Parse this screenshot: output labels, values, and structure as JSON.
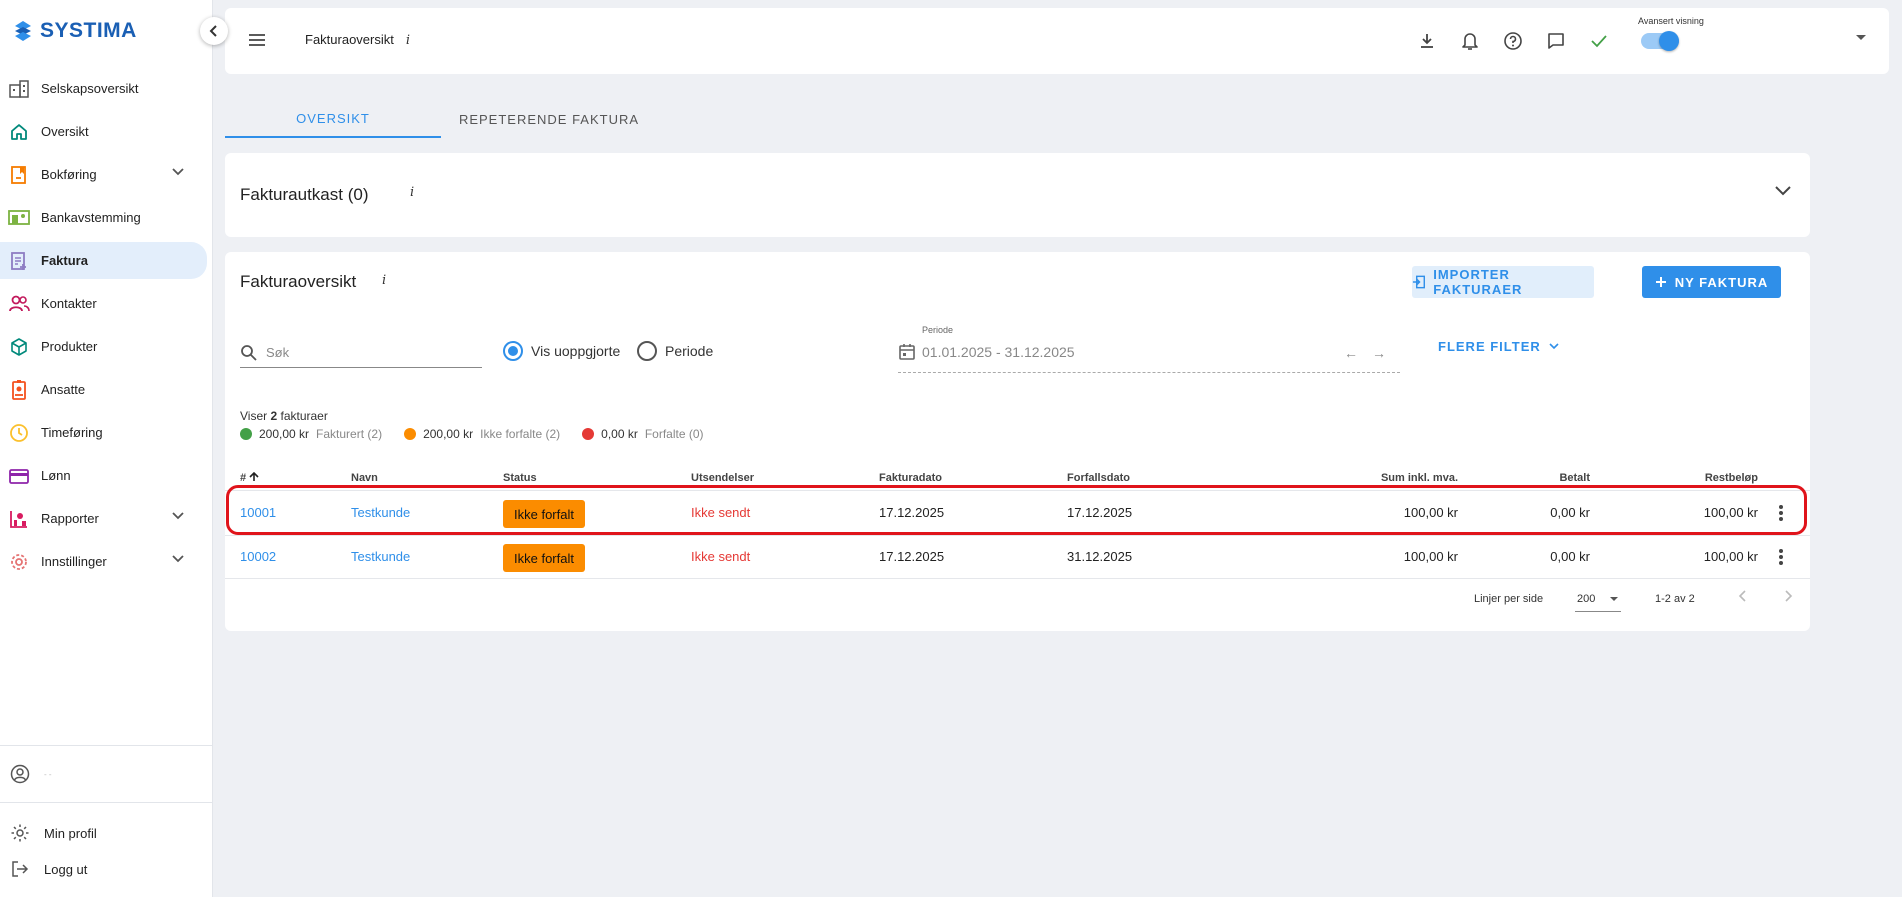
{
  "brand": {
    "name": "SYSTIMA"
  },
  "sidebar": {
    "items": [
      {
        "label": "Selskapsoversikt",
        "icon": "building-icon"
      },
      {
        "label": "Oversikt",
        "icon": "home-icon"
      },
      {
        "label": "Bokføring",
        "icon": "bookkeeping-icon",
        "expandable": true
      },
      {
        "label": "Bankavstemming",
        "icon": "bank-reconciliation-icon"
      },
      {
        "label": "Faktura",
        "icon": "invoice-icon",
        "active": true
      },
      {
        "label": "Kontakter",
        "icon": "contacts-icon"
      },
      {
        "label": "Produkter",
        "icon": "products-icon"
      },
      {
        "label": "Ansatte",
        "icon": "employees-icon"
      },
      {
        "label": "Timeføring",
        "icon": "clock-icon"
      },
      {
        "label": "Lønn",
        "icon": "payroll-icon"
      },
      {
        "label": "Rapporter",
        "icon": "reports-icon",
        "expandable": true
      },
      {
        "label": "Innstillinger",
        "icon": "settings-icon",
        "expandable": true
      }
    ],
    "user_name": "- -",
    "bottom": {
      "profile": "Min profil",
      "logout": "Logg ut"
    }
  },
  "topbar": {
    "title": "Fakturaoversikt",
    "info": "i",
    "toggle_label": "Avansert visning",
    "toggle_on": true
  },
  "tabs": [
    "OVERSIKT",
    "REPETERENDE FAKTURA"
  ],
  "drafts": {
    "title": "Fakturautkast (0)",
    "info": "i"
  },
  "invoices": {
    "title": "Fakturaoversikt",
    "info": "i",
    "import_label": "IMPORTER FAKTURAER",
    "new_label": "NY FAKTURA",
    "search_placeholder": "Søk",
    "radio_unsettled": "Vis uoppgjorte",
    "radio_period": "Periode",
    "period_label": "Periode",
    "period_value": "01.01.2025 - 31.12.2025",
    "more_filter": "FLERE FILTER",
    "showing_prefix": "Viser",
    "showing_count": "2",
    "showing_suffix": "fakturaer",
    "summary": [
      {
        "amount": "200,00 kr",
        "label": "Fakturert (2)",
        "color": "#43a047"
      },
      {
        "amount": "200,00 kr",
        "label": "Ikke forfalte (2)",
        "color": "#fb8c00"
      },
      {
        "amount": "0,00 kr",
        "label": "Forfalte (0)",
        "color": "#e53935"
      }
    ],
    "columns": [
      "#",
      "Navn",
      "Status",
      "Utsendelser",
      "Fakturadato",
      "Forfallsdato",
      "Sum inkl. mva.",
      "Betalt",
      "Restbeløp"
    ],
    "rows": [
      {
        "number": "10001",
        "name": "Testkunde",
        "status": "Ikke forfalt",
        "sending": "Ikke sendt",
        "invoice_date": "17.12.2025",
        "due_date": "17.12.2025",
        "sum": "100,00 kr",
        "paid": "0,00 kr",
        "remaining": "100,00 kr"
      },
      {
        "number": "10002",
        "name": "Testkunde",
        "status": "Ikke forfalt",
        "sending": "Ikke sendt",
        "invoice_date": "17.12.2025",
        "due_date": "31.12.2025",
        "sum": "100,00 kr",
        "paid": "0,00 kr",
        "remaining": "100,00 kr"
      }
    ],
    "footer": {
      "rows_per_page_label": "Linjer per side",
      "rows_per_page": "200",
      "range": "1-2 av 2"
    }
  },
  "colors": {
    "accent": "#2f8fe9",
    "brand": "#1a5fb4",
    "status_orange": "#fb8c00",
    "error_red": "#e53935",
    "highlight_red": "#e0141b"
  }
}
